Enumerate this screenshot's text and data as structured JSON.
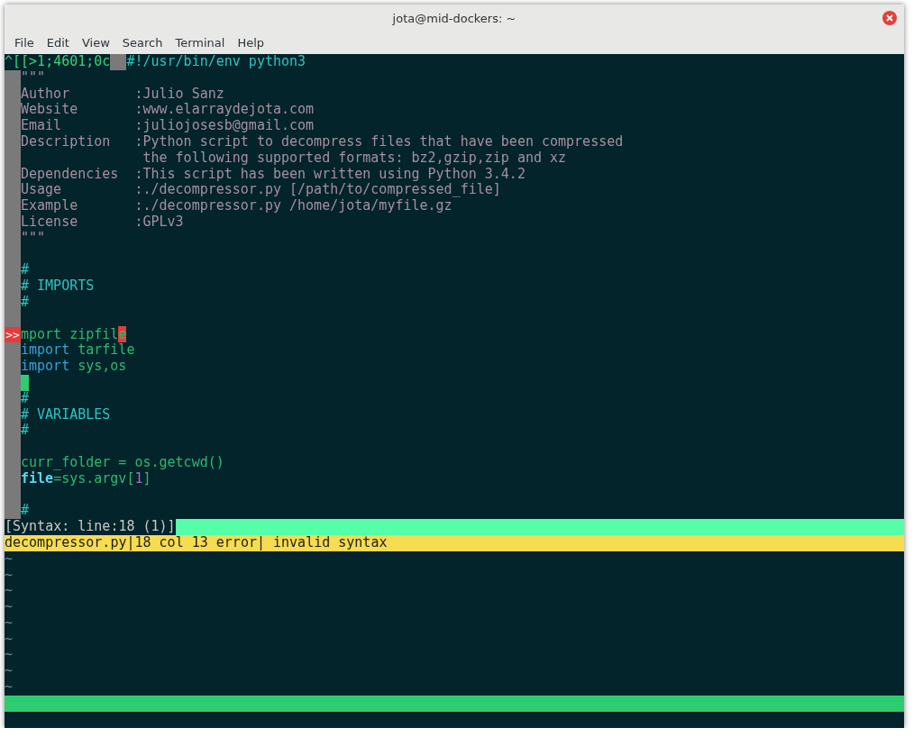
{
  "window": {
    "title": "jota@mid-dockers: ~"
  },
  "menu": [
    "File",
    "Edit",
    "View",
    "Search",
    "Terminal",
    "Help"
  ],
  "escape_line": {
    "prefix": "^[[>1;4601;0c",
    "block": true,
    "text": "#!/usr/bin/env python3"
  },
  "lines": [
    {
      "cursor": false,
      "tokens": [
        {
          "text": "\"\"\"",
          "kind": "doc"
        }
      ]
    },
    {
      "cursor": false,
      "tokens": [
        {
          "text": "Author        :Julio Sanz",
          "kind": "doc"
        }
      ]
    },
    {
      "cursor": false,
      "tokens": [
        {
          "text": "Website       :www.elarraydejota.com",
          "kind": "doc"
        }
      ]
    },
    {
      "cursor": false,
      "tokens": [
        {
          "text": "Email         :juliojosesb@gmail.com",
          "kind": "doc"
        }
      ]
    },
    {
      "cursor": false,
      "tokens": [
        {
          "text": "Description   :Python script to decompress files that have been compressed",
          "kind": "doc"
        }
      ]
    },
    {
      "cursor": false,
      "tokens": [
        {
          "text": "               the following supported formats: bz2,gzip,zip and xz",
          "kind": "doc"
        }
      ]
    },
    {
      "cursor": false,
      "tokens": [
        {
          "text": "Dependencies  :This script has been written using Python 3.4.2",
          "kind": "doc"
        }
      ]
    },
    {
      "cursor": false,
      "tokens": [
        {
          "text": "Usage         :./decompressor.py [/path/to/compressed_file]",
          "kind": "doc"
        }
      ]
    },
    {
      "cursor": false,
      "tokens": [
        {
          "text": "Example       :./decompressor.py /home/jota/myfile.gz",
          "kind": "doc"
        }
      ]
    },
    {
      "cursor": false,
      "tokens": [
        {
          "text": "License       :GPLv3",
          "kind": "doc"
        }
      ]
    },
    {
      "cursor": false,
      "tokens": [
        {
          "text": "\"\"\"",
          "kind": "doc"
        }
      ]
    },
    {
      "cursor": false
    },
    {
      "cursor": false,
      "tokens": [
        {
          "text": "#",
          "kind": "comment"
        }
      ]
    },
    {
      "cursor": false,
      "tokens": [
        {
          "text": "# IMPORTS",
          "kind": "comment"
        }
      ]
    },
    {
      "cursor": false,
      "tokens": [
        {
          "text": "#",
          "kind": "comment"
        }
      ]
    },
    {
      "cursor": false
    },
    {
      "cursor": false,
      "sign": ">>",
      "tokens": [
        {
          "text": "mport zipfil",
          "kind": "name"
        },
        {
          "text": "e",
          "kind": "error"
        }
      ]
    },
    {
      "cursor": false,
      "tokens": [
        {
          "text": "import",
          "kind": "keyword"
        },
        {
          "text": " tarfile",
          "kind": "name"
        }
      ]
    },
    {
      "cursor": false,
      "tokens": [
        {
          "text": "import",
          "kind": "keyword"
        },
        {
          "text": " sys,os",
          "kind": "name"
        }
      ]
    },
    {
      "cursor": true
    },
    {
      "cursor": false,
      "tokens": [
        {
          "text": "#",
          "kind": "comment"
        }
      ]
    },
    {
      "cursor": false,
      "tokens": [
        {
          "text": "# VARIABLES",
          "kind": "comment"
        }
      ]
    },
    {
      "cursor": false,
      "tokens": [
        {
          "text": "#",
          "kind": "comment"
        }
      ]
    },
    {
      "cursor": false
    },
    {
      "cursor": false,
      "tokens": [
        {
          "text": "curr_folder = os.getcwd()",
          "kind": "name"
        }
      ]
    },
    {
      "cursor": false,
      "tokens": [
        {
          "text": "file",
          "kind": "builtin"
        },
        {
          "text": "=sys.argv[",
          "kind": "name"
        },
        {
          "text": "1",
          "kind": "number"
        },
        {
          "text": "]",
          "kind": "name"
        }
      ]
    },
    {
      "cursor": false
    },
    {
      "cursor": false,
      "tokens": [
        {
          "text": "#",
          "kind": "comment"
        }
      ]
    }
  ],
  "syntax_bar": {
    "text": "[Syntax: line:18 (1)]"
  },
  "error_line": {
    "text": "decompressor.py|18 col 13 error| invalid syntax"
  },
  "tildes": [
    "~",
    "~",
    "~",
    "~",
    "~",
    "~",
    "~",
    "~",
    "~"
  ]
}
